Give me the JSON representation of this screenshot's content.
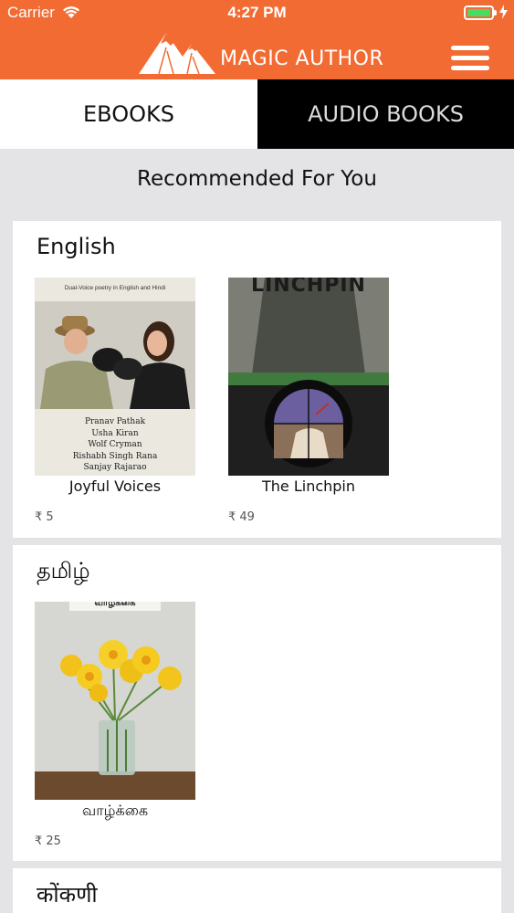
{
  "status_bar": {
    "carrier": "Carrier",
    "time": "4:27 PM"
  },
  "header": {
    "brand": "MAGIC AUTHOR",
    "accent_color": "#f26b33"
  },
  "tabs": [
    {
      "label": "EBOOKS",
      "selected": true
    },
    {
      "label": "AUDIO BOOKS",
      "selected": false
    }
  ],
  "section_title": "Recommended For You",
  "languages": [
    {
      "name": "English",
      "books": [
        {
          "title": "Joyful Voices",
          "price": "₹ 5",
          "cover_tagline": "Dual-Voice poetry in English and Hindi",
          "cover_authors": [
            "Pranav Pathak",
            "Usha Kiran",
            "Wolf Cryman",
            "Rishabh Singh Rana",
            "Sanjay Rajarao"
          ]
        },
        {
          "title": "The Linchpin",
          "price": "₹ 49",
          "cover_heading": "LINCHPIN"
        }
      ]
    },
    {
      "name": "தமிழ்",
      "books": [
        {
          "title": "வாழ்க்கை",
          "price": "₹ 25",
          "cover_heading": "வாழ்க்கை"
        }
      ]
    },
    {
      "name": "कोंकणी",
      "books": []
    }
  ]
}
